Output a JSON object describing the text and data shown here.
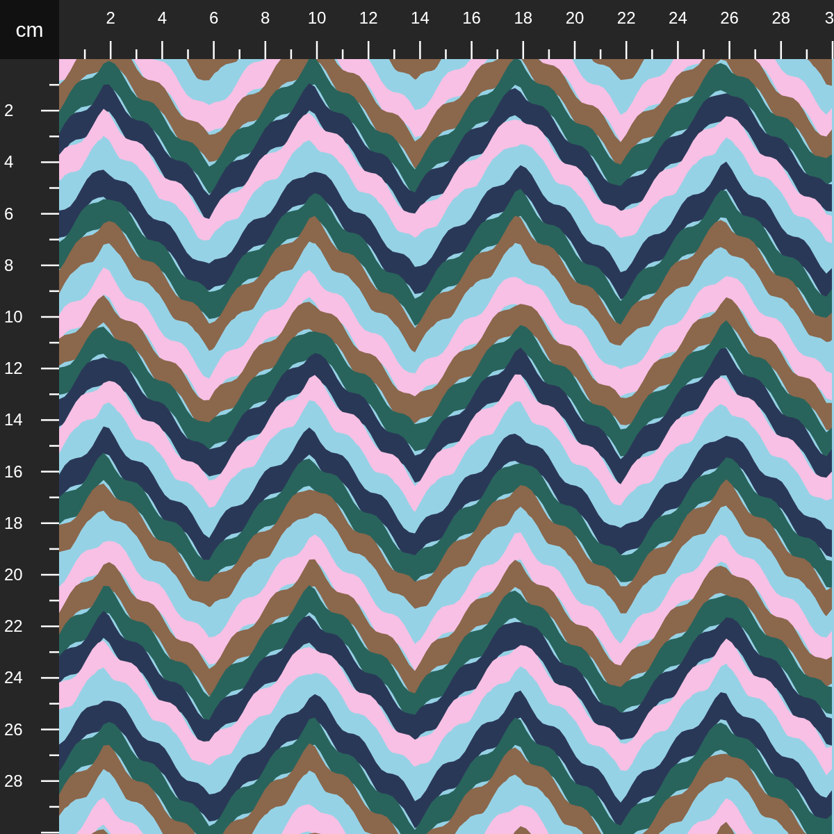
{
  "unit": "cm",
  "top_ruler": {
    "labels": [
      "2",
      "4",
      "6",
      "8",
      "10",
      "12",
      "14",
      "16",
      "18",
      "20",
      "22",
      "24",
      "26",
      "28",
      "3"
    ]
  },
  "left_ruler": {
    "labels": [
      "2",
      "4",
      "6",
      "8",
      "10",
      "12",
      "14",
      "16",
      "18",
      "20",
      "22",
      "24",
      "26",
      "28"
    ]
  }
}
